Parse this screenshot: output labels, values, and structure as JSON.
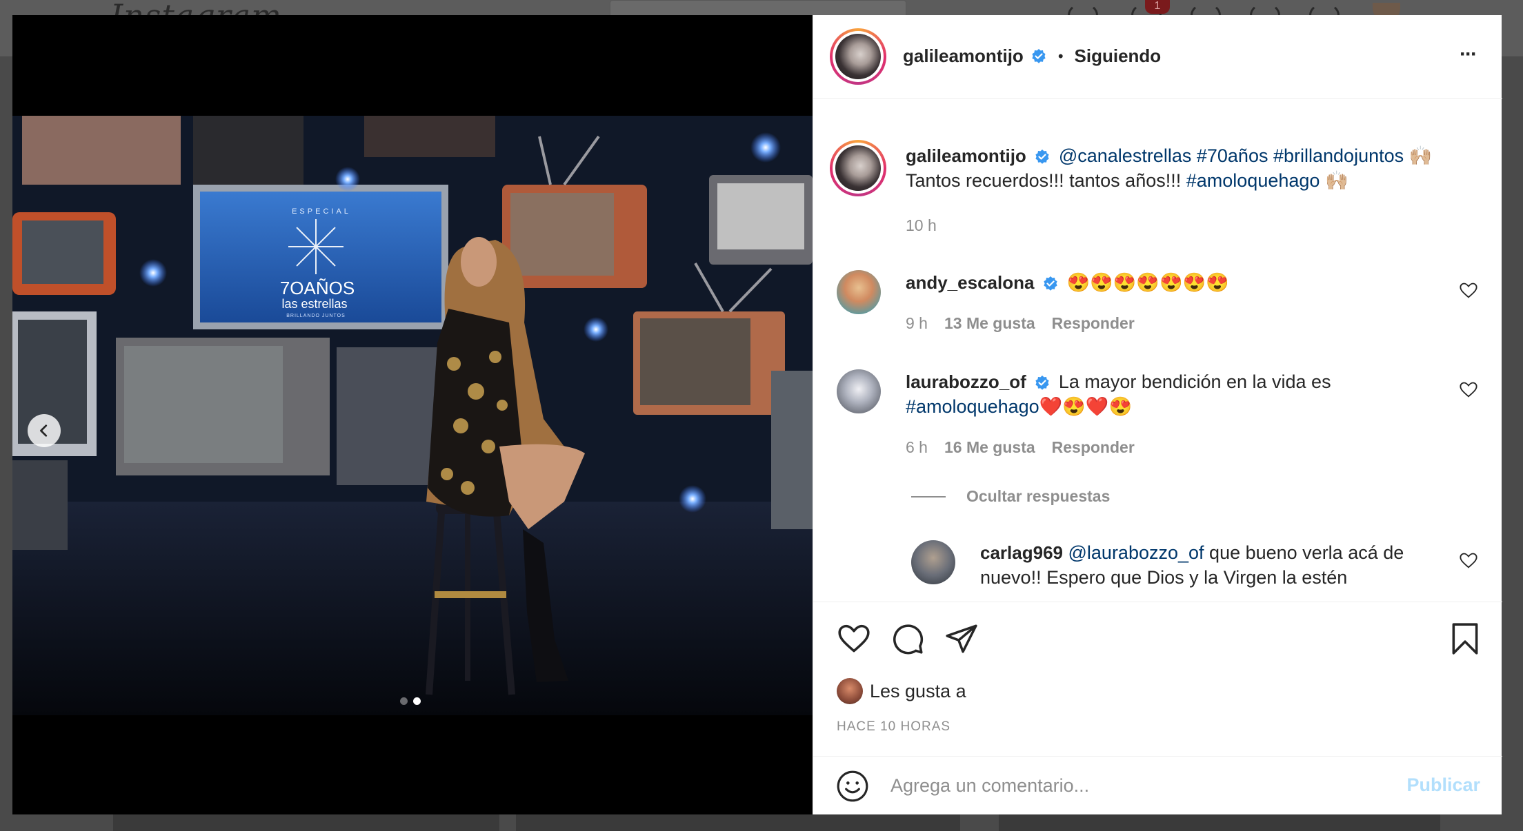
{
  "background": {
    "logo": "Instagram",
    "notification_count": "1"
  },
  "post": {
    "author": "galileamontijo",
    "follow_state": "Siguiendo",
    "separator": "•",
    "more_label": "···",
    "caption": {
      "mention": "@canalestrellas",
      "tags": [
        "#70años",
        "#brillandojuntos"
      ],
      "emoji": "🙌🏼",
      "line2_text": "Tantos recuerdos!!! tantos años!!!",
      "line2_tag": "#amoloquehago",
      "line2_emoji": "🙌🏼",
      "time": "10 h"
    },
    "photo_overlay_text": {
      "special": "ESPECIAL",
      "years": "7OAÑOS",
      "brand": "las estrellas",
      "sub": "BRILLANDO JUNTOS"
    }
  },
  "comments": [
    {
      "username": "andy_escalona",
      "verified": true,
      "text": "😍😍😍😍😍😍😍",
      "time": "9 h",
      "likes": "13 Me gusta",
      "reply": "Responder"
    },
    {
      "username": "laurabozzo_of",
      "verified": true,
      "text_line1": "La mayor bendición en la vida es",
      "tag": "#amoloquehago",
      "emoji_tail": "❤️😍❤️😍",
      "time": "6 h",
      "likes": "16 Me gusta",
      "reply": "Responder",
      "hide_replies": "Ocultar respuestas"
    },
    {
      "username": "carlag969",
      "mention": "@laurabozzo_of",
      "text_line1": "que bueno verla acá de",
      "text_line2": "nuevo!! Espero que Dios y la Virgen la estén"
    }
  ],
  "likes_prefix": "Les gusta a",
  "timestamp": "HACE 10 HORAS",
  "add_comment": {
    "placeholder": "Agrega un comentario...",
    "publish": "Publicar"
  },
  "icons": {
    "verified": "verified-badge-icon",
    "like": "heart-icon",
    "comment": "comment-icon",
    "share": "send-icon",
    "save": "bookmark-icon",
    "emoji": "emoji-icon",
    "prev": "chevron-left-icon"
  },
  "colors": {
    "link": "#00376b",
    "muted": "#8e8e8e",
    "verified": "#3897f0",
    "publish_disabled": "#b2dffc"
  }
}
